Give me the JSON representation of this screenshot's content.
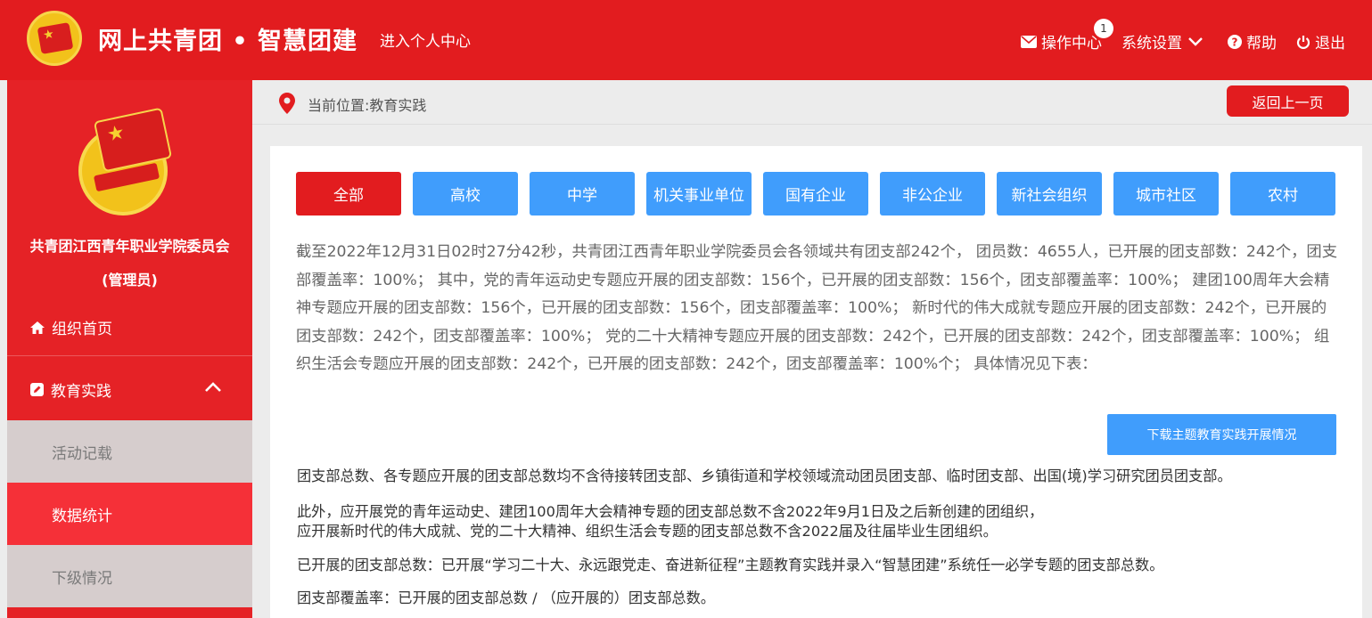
{
  "header": {
    "title": "网上共青团 • 智慧团建",
    "personal_center": "进入个人中心",
    "nav": {
      "ops_center": "操作中心",
      "ops_badge": "1",
      "settings": "系统设置",
      "help": "帮助",
      "logout": "退出"
    },
    "colors": {
      "brand_red": "#e21c1f",
      "tab_blue": "#409dfc"
    }
  },
  "sidebar": {
    "org_name_line1": "共青团江西青年职业学院委员会",
    "org_name_line2": "(管理员)",
    "home": "组织首页",
    "edu": "教育实践",
    "sub_items": [
      "活动记载",
      "数据统计",
      "下级情况"
    ],
    "active_sub": "数据统计"
  },
  "breadcrumb": {
    "text": "当前位置:教育实践",
    "back": "返回上一页"
  },
  "tabs": [
    "全部",
    "高校",
    "中学",
    "机关事业单位",
    "国有企业",
    "非公企业",
    "新社会组织",
    "城市社区",
    "农村"
  ],
  "active_tab": "全部",
  "summary": "截至2022年12月31日02时27分42秒，共青团江西青年职业学院委员会各领域共有团支部242个， 团员数：4655人，已开展的团支部数：242个，团支部覆盖率：100%； 其中，党的青年运动史专题应开展的团支部数：156个，已开展的团支部数：156个，团支部覆盖率：100%； 建团100周年大会精神专题应开展的团支部数：156个，已开展的团支部数：156个，团支部覆盖率：100%； 新时代的伟大成就专题应开展的团支部数：242个，已开展的团支部数：242个，团支部覆盖率：100%； 党的二十大精神专题应开展的团支部数：242个，已开展的团支部数：242个，团支部覆盖率：100%； 组织生活会专题应开展的团支部数：242个，已开展的团支部数：242个，团支部覆盖率：100%个； 具体情况见下表：",
  "download": "下载主题教育实践开展情况",
  "notes": {
    "n1": "团支部总数、各专题应开展的团支部总数均不含待接转团支部、乡镇街道和学校领域流动团员团支部、临时团支部、出国(境)学习研究团员团支部。",
    "n2a": "此外，应开展党的青年运动史、建团100周年大会精神专题的团支部总数不含2022年9月1日及之后新创建的团组织，",
    "n2b": "应开展新时代的伟大成就、党的二十大精神、组织生活会专题的团支部总数不含2022届及往届毕业生团组织。",
    "n3": "已开展的团支部总数：已开展“学习二十大、永远跟党走、奋进新征程”主题教育实践并录入“智慧团建”系统任一必学专题的团支部总数。",
    "n4": "团支部覆盖率：已开展的团支部总数 / （应开展的）团支部总数。"
  }
}
